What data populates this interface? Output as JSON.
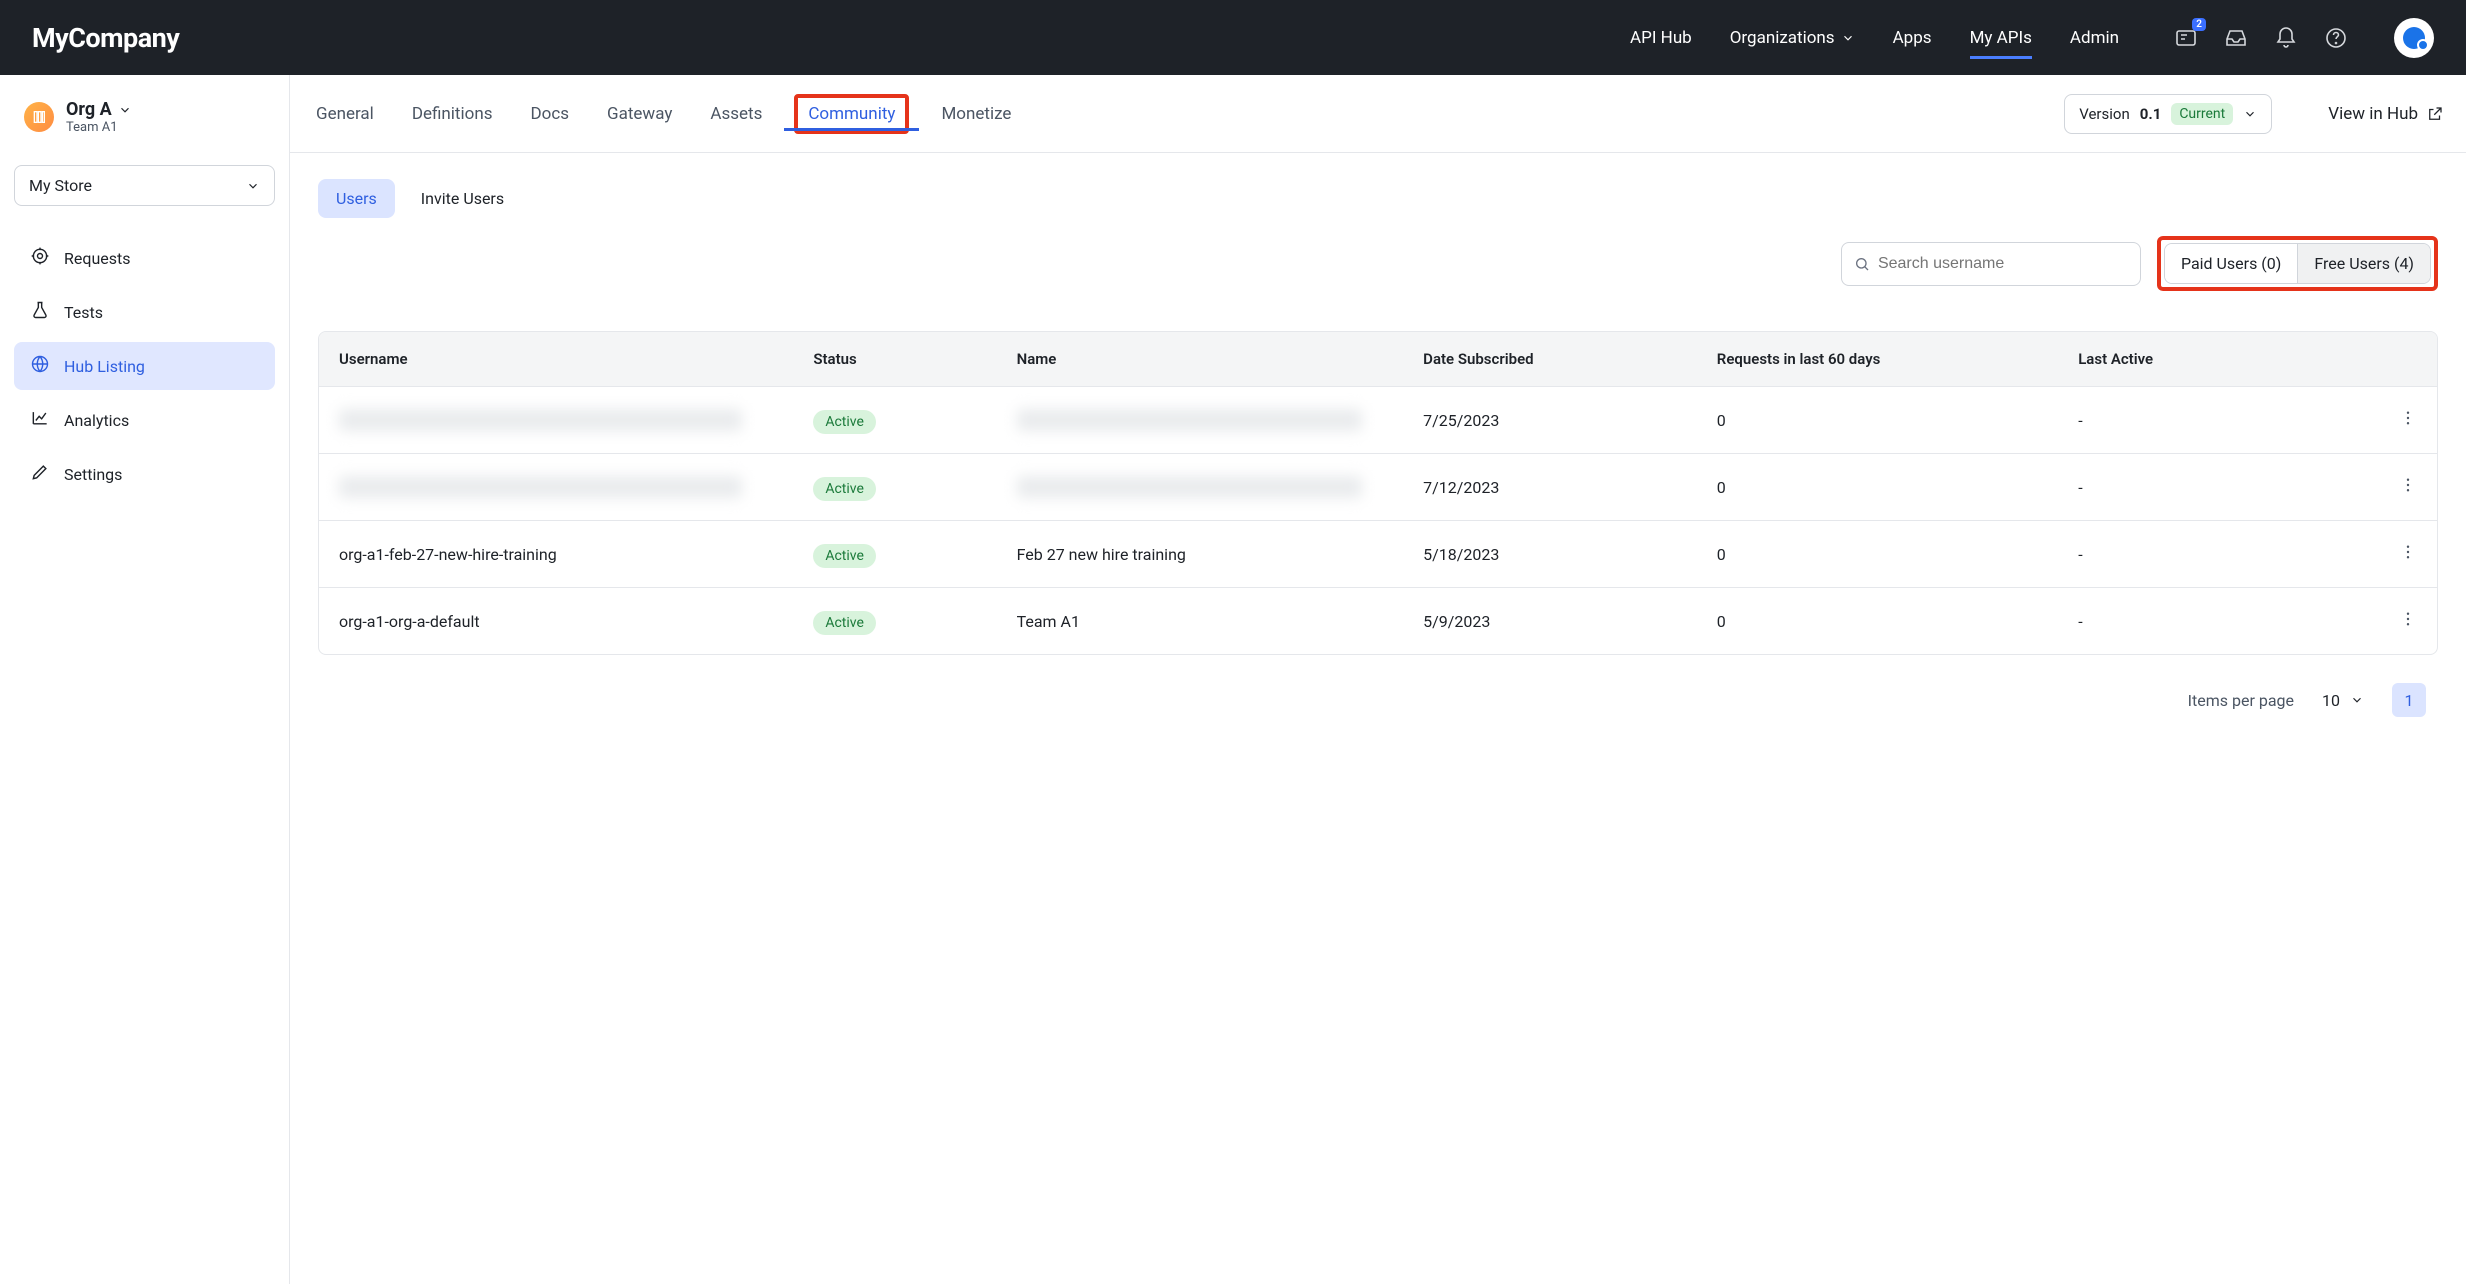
{
  "brand": "MyCompany",
  "topnav": {
    "links": [
      {
        "label": "API Hub",
        "active": false,
        "dropdown": false
      },
      {
        "label": "Organizations",
        "active": false,
        "dropdown": true
      },
      {
        "label": "Apps",
        "active": false,
        "dropdown": false
      },
      {
        "label": "My APIs",
        "active": true,
        "dropdown": false
      },
      {
        "label": "Admin",
        "active": false,
        "dropdown": false
      }
    ],
    "notif_badge": "2"
  },
  "sidebar": {
    "org_name": "Org A",
    "team_name": "Team A1",
    "store_selector": "My Store",
    "items": [
      {
        "label": "Requests",
        "icon": "target-icon",
        "active": false
      },
      {
        "label": "Tests",
        "icon": "flask-icon",
        "active": false
      },
      {
        "label": "Hub Listing",
        "icon": "globe-icon",
        "active": true
      },
      {
        "label": "Analytics",
        "icon": "chart-icon",
        "active": false
      },
      {
        "label": "Settings",
        "icon": "pencil-icon",
        "active": false
      }
    ]
  },
  "tabs": [
    {
      "label": "General",
      "active": false
    },
    {
      "label": "Definitions",
      "active": false
    },
    {
      "label": "Docs",
      "active": false
    },
    {
      "label": "Gateway",
      "active": false
    },
    {
      "label": "Assets",
      "active": false
    },
    {
      "label": "Community",
      "active": true,
      "highlight": true
    },
    {
      "label": "Monetize",
      "active": false
    }
  ],
  "version": {
    "prefix": "Version",
    "value": "0.1",
    "chip": "Current"
  },
  "view_in_hub": "View in Hub",
  "subtabs": [
    {
      "label": "Users",
      "active": true
    },
    {
      "label": "Invite Users",
      "active": false
    }
  ],
  "search_placeholder": "Search username",
  "user_filters": [
    {
      "label": "Paid Users (0)",
      "active": false
    },
    {
      "label": "Free Users (4)",
      "active": true
    }
  ],
  "table": {
    "headers": [
      "Username",
      "Status",
      "Name",
      "Date Subscribed",
      "Requests in last 60 days",
      "Last Active",
      ""
    ],
    "rows": [
      {
        "username": null,
        "status": "Active",
        "name": null,
        "date": "7/25/2023",
        "requests": "0",
        "last_active": "-"
      },
      {
        "username": null,
        "status": "Active",
        "name": null,
        "date": "7/12/2023",
        "requests": "0",
        "last_active": "-"
      },
      {
        "username": "org-a1-feb-27-new-hire-training",
        "status": "Active",
        "name": "Feb 27 new hire training",
        "date": "5/18/2023",
        "requests": "0",
        "last_active": "-"
      },
      {
        "username": "org-a1-org-a-default",
        "status": "Active",
        "name": "Team A1",
        "date": "5/9/2023",
        "requests": "0",
        "last_active": "-"
      }
    ]
  },
  "pager": {
    "label": "Items per page",
    "per_page": "10",
    "page": "1"
  }
}
